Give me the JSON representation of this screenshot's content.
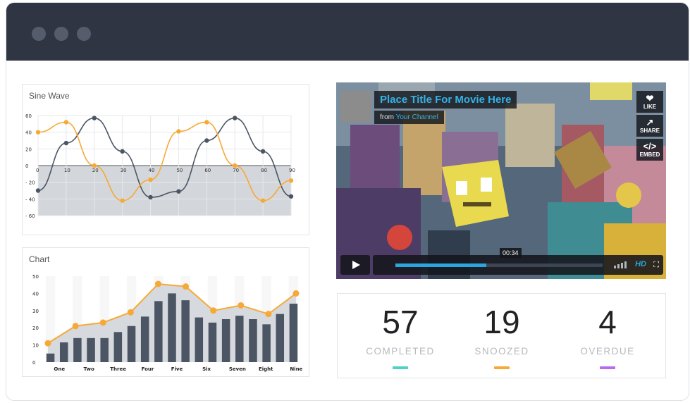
{
  "window": {
    "controls": [
      "close-dot",
      "minimize-dot",
      "maximize-dot"
    ]
  },
  "sine_chart": {
    "title": "Sine Wave",
    "chart_data": {
      "type": "line",
      "title": "Sine Wave",
      "x": [
        0,
        10,
        20,
        30,
        40,
        50,
        60,
        70,
        80,
        90
      ],
      "ylim": [
        -60,
        60
      ],
      "yticks": [
        60,
        40,
        20,
        0,
        -20,
        -40,
        -60
      ],
      "ytick_labels": [
        "60",
        "40",
        "20",
        "0",
        "- 20",
        "- 40",
        "- 60"
      ],
      "xtick_labels": [
        "0",
        "10",
        "20",
        "30",
        "40",
        "50",
        "60",
        "70",
        "80",
        "90"
      ],
      "series": [
        {
          "color": "#4b5563",
          "x": [
            0,
            10,
            20,
            30,
            40,
            50,
            60,
            70,
            80,
            90
          ],
          "values": [
            -30,
            27,
            57,
            17,
            -38,
            -31,
            30,
            57,
            17,
            -37
          ]
        },
        {
          "color": "#f7a935",
          "x": [
            0,
            10,
            20,
            30,
            40,
            50,
            60,
            70,
            80,
            90
          ],
          "values": [
            40,
            52,
            0,
            -42,
            -17,
            41,
            52,
            0,
            -42,
            -18
          ]
        }
      ],
      "grid": true
    }
  },
  "bar_chart": {
    "title": "Chart",
    "chart_data": {
      "type": "bar",
      "title": "Chart",
      "categories": [
        "One",
        "Two",
        "Three",
        "Four",
        "Five",
        "Six",
        "Seven",
        "Eight",
        "Nine"
      ],
      "ylim": [
        0,
        50
      ],
      "yticks": [
        0,
        10,
        20,
        30,
        40,
        50
      ],
      "bars": [
        5,
        11.5,
        14,
        14,
        14,
        17.5,
        21,
        26.5,
        35.5,
        40,
        36,
        26,
        23,
        25,
        27,
        25,
        22,
        28,
        34
      ],
      "line": [
        11,
        21,
        23,
        29,
        45.5,
        44,
        30,
        33,
        28,
        40
      ],
      "bar_color": "#4b5563",
      "line_color": "#f7a935",
      "grid": true
    }
  },
  "video": {
    "title": "Place Title For Movie Here",
    "from_prefix": "from",
    "channel": "Your Channel",
    "like_label": "LIKE",
    "share_label": "SHARE",
    "embed_label": "EMBED",
    "time": "00:34",
    "progress": 0.44,
    "hd_label": "HD"
  },
  "stats": [
    {
      "value": "57",
      "label": "COMPLETED",
      "color": "#4fd1c5"
    },
    {
      "value": "19",
      "label": "SNOOZED",
      "color": "#f7a935"
    },
    {
      "value": "4",
      "label": "OVERDUE",
      "color": "#b86bf0"
    }
  ]
}
